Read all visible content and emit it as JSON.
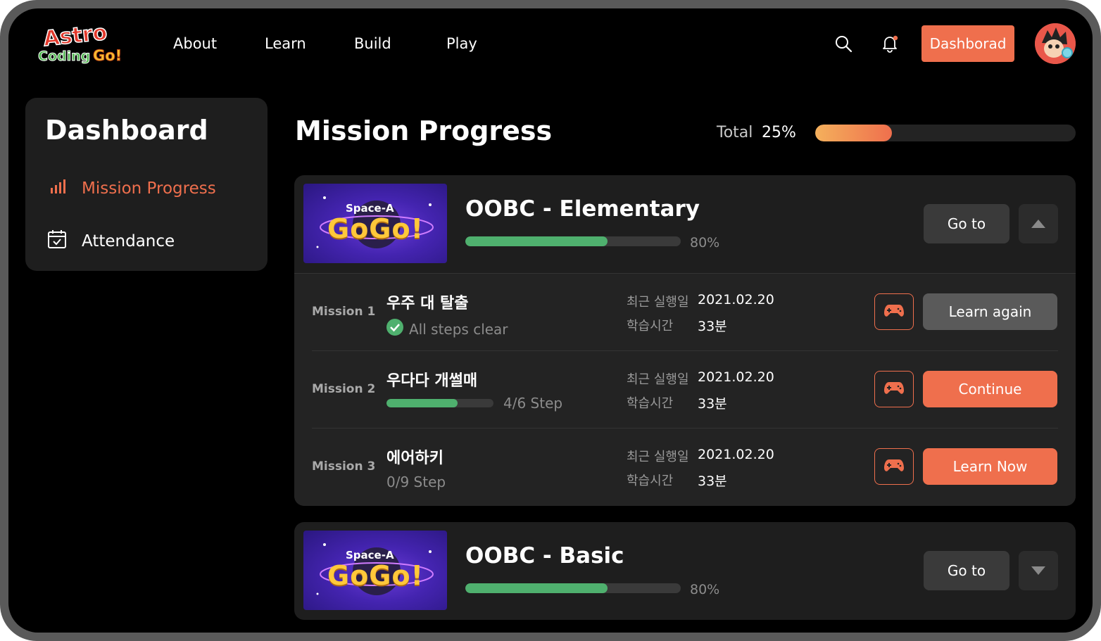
{
  "logo": {
    "line1": "Astro",
    "line2": "Coding Go!"
  },
  "nav": {
    "links": [
      "About",
      "Learn",
      "Build",
      "Play"
    ],
    "icons": [
      "search-icon",
      "bell-icon"
    ],
    "dashboard_label": "Dashborad"
  },
  "sidebar": {
    "title": "Dashboard",
    "items": [
      {
        "label": "Mission Progress",
        "icon": "bar-chart-icon",
        "active": true
      },
      {
        "label": "Attendance",
        "icon": "calendar-check-icon",
        "active": false
      }
    ]
  },
  "main": {
    "title": "Mission Progress",
    "total_label": "Total",
    "total_percent": "25%",
    "total_value": 0.25
  },
  "courses": [
    {
      "thumbnail": {
        "subtitle": "Space-A",
        "title": "GoGo!"
      },
      "title": "OOBC - Elementary",
      "percent_label": "80%",
      "percent": 0.66,
      "goto_label": "Go to",
      "expanded": true,
      "missions": [
        {
          "label": "Mission 1",
          "name": "우주 대 탈출",
          "status": "All steps clear",
          "completed": true,
          "last_run_key": "최근 실행일",
          "last_run": "2021.02.20",
          "study_key": "학습시간",
          "study_time": "33분",
          "action": "Learn again"
        },
        {
          "label": "Mission 2",
          "name": "우다다 개썰매",
          "status": "4/6 Step",
          "progress": 0.667,
          "last_run_key": "최근 실행일",
          "last_run": "2021.02.20",
          "study_key": "학습시간",
          "study_time": "33분",
          "action": "Continue"
        },
        {
          "label": "Mission 3",
          "name": "에어하키",
          "status": "0/9 Step",
          "last_run_key": "최근 실행일",
          "last_run": "2021.02.20",
          "study_key": "학습시간",
          "study_time": "33분",
          "action": "Learn Now"
        }
      ]
    },
    {
      "thumbnail": {
        "subtitle": "Space-A",
        "title": "GoGo!"
      },
      "title": "OOBC - Basic",
      "percent_label": "80%",
      "percent": 0.66,
      "goto_label": "Go to",
      "expanded": false
    }
  ],
  "colors": {
    "accent": "#ef6f4d",
    "progress_green": "#4fb06e",
    "panel": "#1e1e1e"
  }
}
